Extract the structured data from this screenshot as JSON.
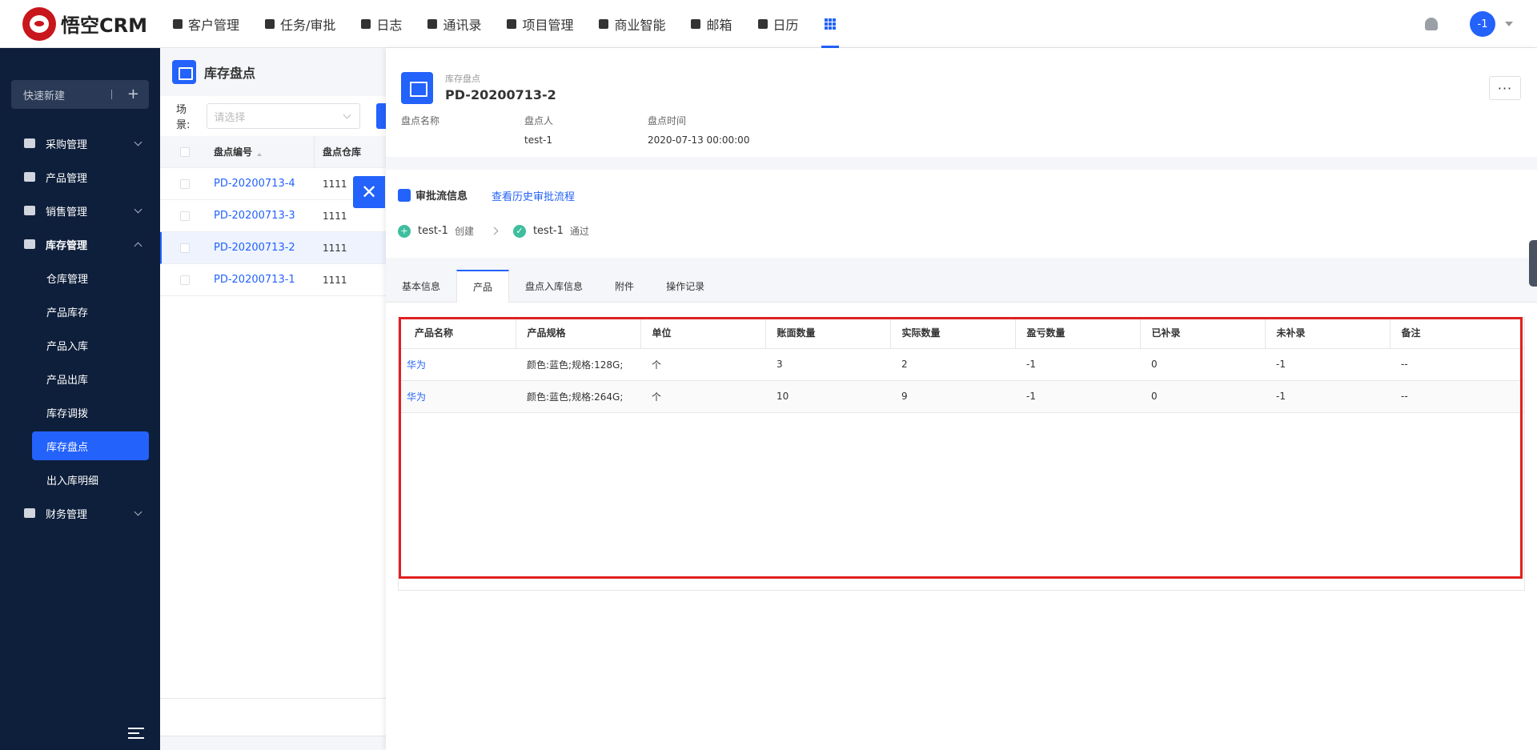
{
  "brand": {
    "name": "悟空CRM"
  },
  "nav": [
    {
      "label": "客户管理",
      "icon": "customer-icon"
    },
    {
      "label": "任务/审批",
      "icon": "briefcase-icon"
    },
    {
      "label": "日志",
      "icon": "log-icon"
    },
    {
      "label": "通讯录",
      "icon": "contacts-icon"
    },
    {
      "label": "项目管理",
      "icon": "project-icon"
    },
    {
      "label": "商业智能",
      "icon": "bi-icon"
    },
    {
      "label": "邮箱",
      "icon": "mail-icon"
    },
    {
      "label": "日历",
      "icon": "calendar-icon"
    }
  ],
  "user": {
    "avatar_text": "-1"
  },
  "sidebar": {
    "quick_create": "快速新建",
    "menu": [
      {
        "label": "采购管理"
      },
      {
        "label": "产品管理"
      },
      {
        "label": "销售管理"
      },
      {
        "label": "库存管理"
      },
      {
        "label": "财务管理"
      }
    ],
    "sub": [
      {
        "label": "仓库管理"
      },
      {
        "label": "产品库存"
      },
      {
        "label": "产品入库"
      },
      {
        "label": "产品出库"
      },
      {
        "label": "库存调拨"
      },
      {
        "label": "库存盘点"
      },
      {
        "label": "出入库明细"
      }
    ]
  },
  "list": {
    "title": "库存盘点",
    "scene_label": "场景:",
    "scene_placeholder": "请选择",
    "col_code": "盘点编号",
    "col_warehouse": "盘点仓库",
    "rows": [
      {
        "code": "PD-20200713-4",
        "wh": "1111"
      },
      {
        "code": "PD-20200713-3",
        "wh": "1111"
      },
      {
        "code": "PD-20200713-2",
        "wh": "1111"
      },
      {
        "code": "PD-20200713-1",
        "wh": "1111"
      }
    ]
  },
  "detail": {
    "type_label": "库存盘点",
    "title": "PD-20200713-2",
    "more": "···",
    "fields": [
      {
        "label": "盘点名称",
        "value": ""
      },
      {
        "label": "盘点人",
        "value": "test-1"
      },
      {
        "label": "盘点时间",
        "value": "2020-07-13 00:00:00"
      }
    ],
    "approval": {
      "title": "审批流信息",
      "history_link": "查看历史审批流程",
      "steps": [
        {
          "user": "test-1",
          "action": "创建"
        },
        {
          "user": "test-1",
          "action": "通过"
        }
      ]
    },
    "tabs": [
      "基本信息",
      "产品",
      "盘点入库信息",
      "附件",
      "操作记录"
    ],
    "product_table": {
      "headers": [
        "产品名称",
        "产品规格",
        "单位",
        "账面数量",
        "实际数量",
        "盈亏数量",
        "已补录",
        "未补录",
        "备注"
      ],
      "rows": [
        [
          "华为",
          "颜色:蓝色;规格:128G;",
          "个",
          "3",
          "2",
          "-1",
          "0",
          "-1",
          "--"
        ],
        [
          "华为",
          "颜色:蓝色;规格:264G;",
          "个",
          "10",
          "9",
          "-1",
          "0",
          "-1",
          "--"
        ]
      ]
    }
  }
}
